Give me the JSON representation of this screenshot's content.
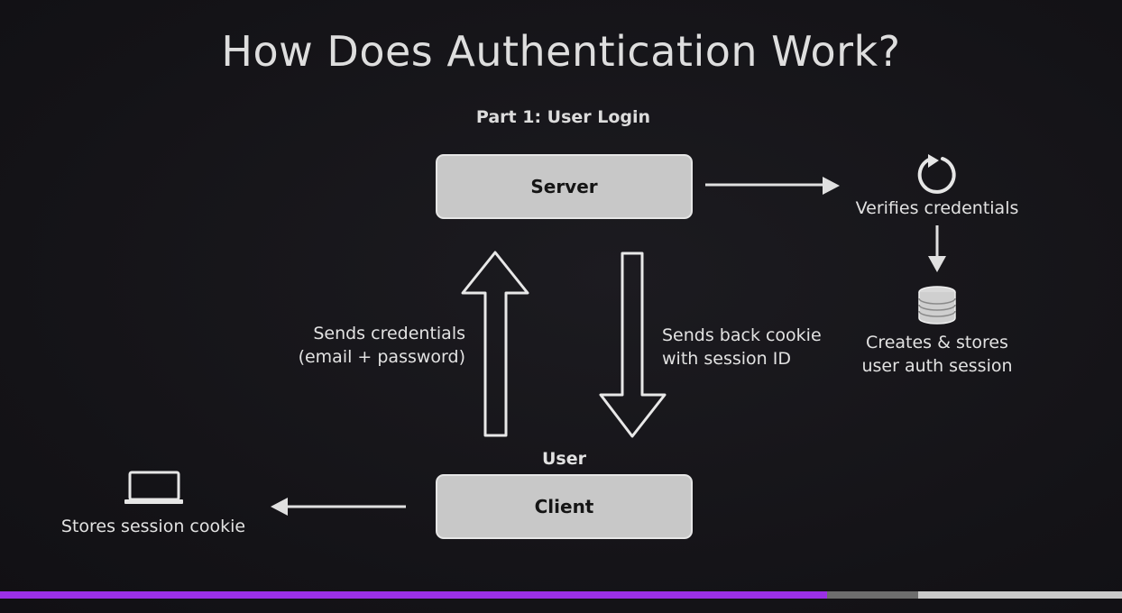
{
  "slide": {
    "title": "How Does Authentication Work?",
    "subtitle": "Part 1: User Login"
  },
  "nodes": {
    "server": "Server",
    "client": "Client",
    "user_label": "User"
  },
  "flows": {
    "sends_credentials": [
      "Sends credentials",
      "(email + password)"
    ],
    "sends_back_cookie": [
      "Sends back cookie",
      "with session ID"
    ],
    "verifies": "Verifies credentials",
    "creates_session": [
      "Creates & stores",
      "user auth session"
    ],
    "stores_cookie": "Stores session cookie"
  },
  "icons": {
    "refresh": "refresh-icon",
    "database": "database-icon",
    "laptop": "laptop-icon"
  },
  "player": {
    "progress_fraction": 0.737,
    "buffered_fraction": 0.818,
    "accent_color": "#9b30e6"
  }
}
